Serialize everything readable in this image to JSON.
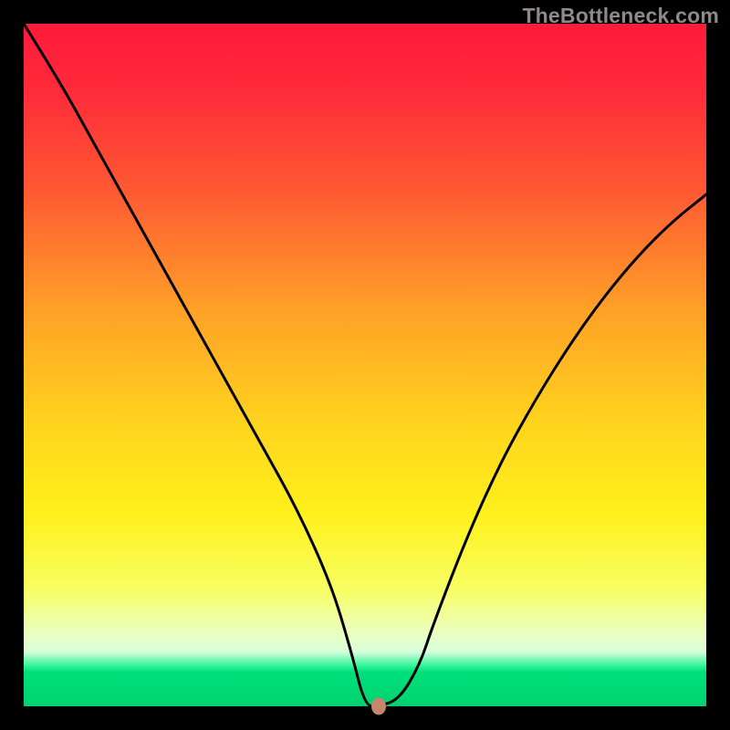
{
  "watermark": "TheBottleneck.com",
  "colors": {
    "frame": "#000000",
    "grad_top": "#ff1a3a",
    "grad_bottom": "#00d26f",
    "curve": "#000000",
    "marker": "#c8856e"
  },
  "chart_data": {
    "type": "line",
    "title": "",
    "xlabel": "",
    "ylabel": "",
    "xlim": [
      0,
      100
    ],
    "ylim": [
      0,
      100
    ],
    "series": [
      {
        "name": "bottleneck-curve",
        "x": [
          0,
          5,
          10,
          15,
          20,
          25,
          30,
          35,
          40,
          45,
          48,
          50,
          52,
          55,
          58,
          60,
          65,
          70,
          75,
          80,
          85,
          90,
          95,
          100
        ],
        "values": [
          100,
          92,
          83,
          74,
          65,
          56,
          47,
          38,
          29,
          18,
          8,
          0,
          0,
          1,
          6,
          12,
          25,
          36,
          45,
          53,
          60,
          66,
          71,
          75
        ]
      }
    ],
    "annotations": [
      {
        "name": "current-config-marker",
        "x": 52,
        "y": 0
      }
    ],
    "grid": false
  }
}
